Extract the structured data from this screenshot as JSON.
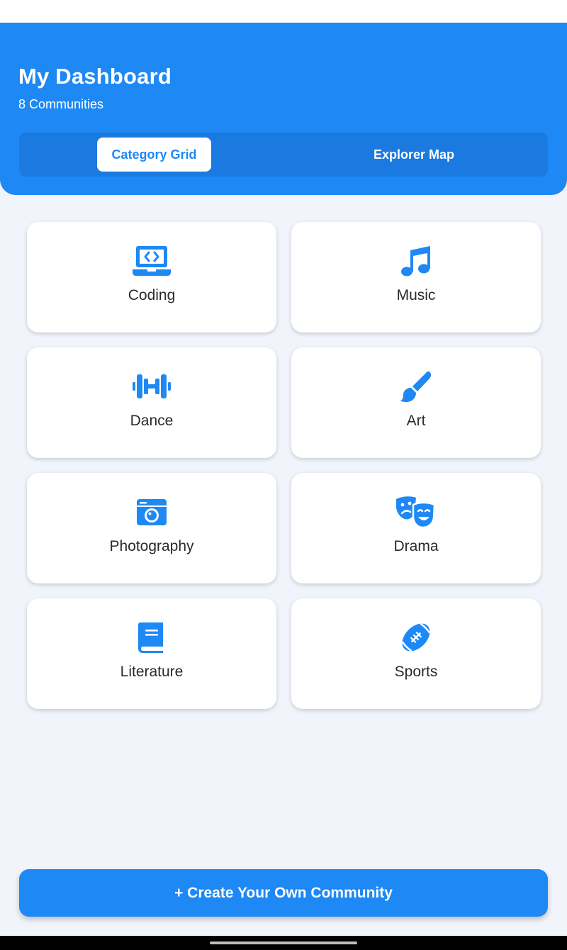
{
  "header": {
    "title": "My Dashboard",
    "subtitle": "8 Communities",
    "background_color": "#1E88F5"
  },
  "view_toggle": {
    "active": "Category Grid",
    "options": [
      "Category Grid",
      "Explorer Map"
    ]
  },
  "categories": [
    {
      "label": "Coding",
      "icon": "laptop-code-icon"
    },
    {
      "label": "Music",
      "icon": "music-note-icon"
    },
    {
      "label": "Dance",
      "icon": "dumbbell-icon"
    },
    {
      "label": "Art",
      "icon": "paintbrush-icon"
    },
    {
      "label": "Photography",
      "icon": "camera-icon"
    },
    {
      "label": "Drama",
      "icon": "theater-masks-icon"
    },
    {
      "label": "Literature",
      "icon": "book-icon"
    },
    {
      "label": "Sports",
      "icon": "football-icon"
    }
  ],
  "cta": {
    "label": "+ Create Your Own Community"
  },
  "colors": {
    "accent": "#1E88F5",
    "background": "#F1F5FB",
    "card": "#FFFFFF",
    "label": "#2A2A2A"
  }
}
